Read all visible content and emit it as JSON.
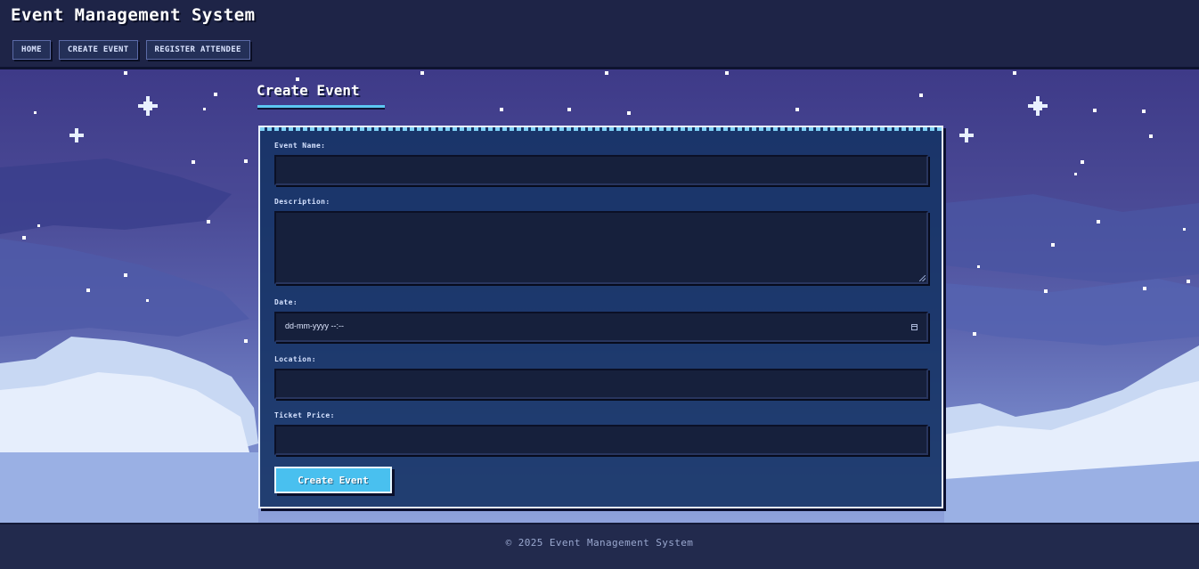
{
  "header": {
    "title": "Event Management System",
    "nav": [
      {
        "label": "HOME"
      },
      {
        "label": "CREATE EVENT"
      },
      {
        "label": "REGISTER ATTENDEE"
      }
    ]
  },
  "main": {
    "page_title": "Create Event",
    "form": {
      "event_name": {
        "label": "Event Name:",
        "value": ""
      },
      "description": {
        "label": "Description:",
        "value": ""
      },
      "date": {
        "label": "Date:",
        "placeholder": "dd-mm-yyyy --:--"
      },
      "location": {
        "label": "Location:",
        "value": ""
      },
      "ticket_price": {
        "label": "Ticket Price:",
        "value": ""
      },
      "submit_label": "Create Event"
    }
  },
  "footer": {
    "text": "© 2025 Event Management System"
  },
  "colors": {
    "accent": "#49c0ef",
    "header_bg": "#1e2447",
    "panel_bg": "#163466",
    "sky": "#3e3a88"
  }
}
